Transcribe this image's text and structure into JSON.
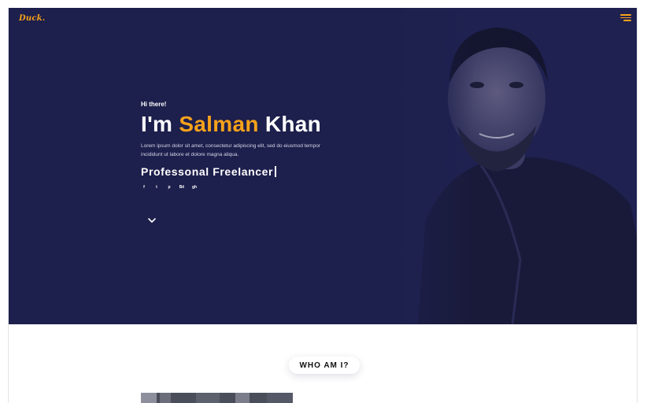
{
  "brand": {
    "logo": "Duck."
  },
  "hero": {
    "greeting": "Hi there!",
    "name_prefix": "I'm ",
    "name_highlight": "Salman",
    "name_suffix": " Khan",
    "lead": "Lorem ipsum dolor sit amet, consectetur adipiscing elit, sed do eiusmod tempor incididunt ut labore et dolore magna aliqua.",
    "role": "Professonal Freelancer",
    "socials": [
      {
        "label": "f",
        "icon": "facebook-icon"
      },
      {
        "label": "t",
        "icon": "twitter-icon"
      },
      {
        "label": "p",
        "icon": "pinterest-icon"
      },
      {
        "label": "Bē",
        "icon": "behance-icon"
      },
      {
        "label": "gh",
        "icon": "github-icon"
      }
    ]
  },
  "about": {
    "badge": "WHO AM I?"
  },
  "colors": {
    "hero_bg": "#1d1f4c",
    "accent": "#f7a21b",
    "text_light": "#ffffff"
  }
}
